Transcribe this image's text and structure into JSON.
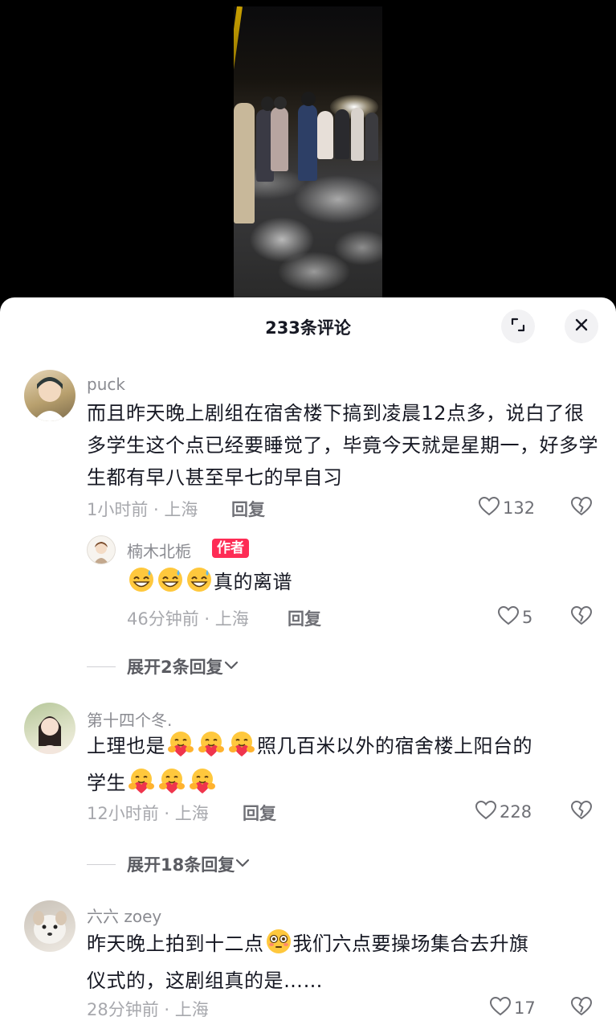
{
  "sheet": {
    "title": "233条评论",
    "expand_icon": "expand-icon",
    "close_icon": "close-icon"
  },
  "comments": [
    {
      "username": "puck",
      "text": "而且昨天晚上剧组在宿舍楼下搞到凌晨12点多，说白了很多学生这个点已经要睡觉了，毕竟今天就是星期一，好多学生都有早八甚至早七的早自习",
      "meta": "1小时前 · 上海",
      "reply_label": "回复",
      "likes": "132"
    },
    {
      "username": "楠木北栀",
      "author_tag": "作者",
      "text_emojis": [
        "sweat-grin-emoji",
        "sweat-grin-emoji",
        "sweat-grin-emoji"
      ],
      "text": "真的离谱",
      "meta": "46分钟前 · 上海",
      "reply_label": "回复",
      "likes": "5"
    },
    {
      "username": "第十四个冬.",
      "text_part1": "上理也是",
      "text_emojis_1": [
        "hug-emoji",
        "hug-emoji",
        "hug-emoji"
      ],
      "text_part2": "照几百米以外的宿舍楼上阳台的",
      "text_part3": "学生",
      "text_emojis_2": [
        "hug-emoji",
        "hug-emoji",
        "hug-emoji"
      ],
      "meta": "12小时前 · 上海",
      "reply_label": "回复",
      "likes": "228"
    },
    {
      "username": "六六 zoey",
      "text_part1": "昨天晚上拍到十二点",
      "text_emoji": "flushed-emoji",
      "text_part2": "我们六点要操场集合去升旗",
      "text_part3": "仪式的，这剧组真的是……",
      "meta": "28分钟前 · 上海",
      "likes": "17"
    }
  ],
  "expand_replies": [
    {
      "label": "展开2条回复"
    },
    {
      "label": "展开18条回复"
    }
  ],
  "colors": {
    "accent": "#fe2c55",
    "text_primary": "#161823",
    "text_secondary": "#8a8b91"
  }
}
